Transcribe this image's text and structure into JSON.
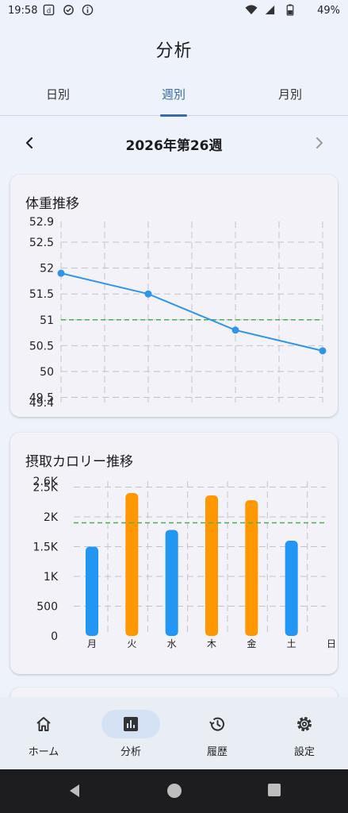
{
  "status_bar": {
    "time": "19:58",
    "battery": "49%"
  },
  "app_bar": {
    "title": "分析"
  },
  "tabs": [
    {
      "label": "日別",
      "active": false
    },
    {
      "label": "週別",
      "active": true
    },
    {
      "label": "月別",
      "active": false
    }
  ],
  "week_nav": {
    "title": "2026年第26週",
    "prev_icon": "chevron-left-icon",
    "next_icon": "chevron-right-icon"
  },
  "weight_card": {
    "title": "体重推移"
  },
  "calorie_card": {
    "title": "摂取カロリー推移"
  },
  "chart_data": [
    {
      "type": "line",
      "title": "体重推移",
      "y_tick_labels": [
        "52.9",
        "52.5",
        "52",
        "51.5",
        "51",
        "50.5",
        "50",
        "49.5",
        "49.4"
      ],
      "ylim": [
        49.4,
        52.9
      ],
      "x_positions": [
        0,
        1,
        2,
        3,
        4,
        5,
        6
      ],
      "series": [
        {
          "points": [
            [
              0,
              51.9
            ],
            [
              2,
              51.5
            ],
            [
              4,
              50.8
            ],
            [
              6,
              50.4
            ]
          ],
          "color": "#2f95e8"
        }
      ],
      "target_line": {
        "value": 51.0,
        "color": "#4caf50"
      },
      "grid": true
    },
    {
      "type": "bar",
      "title": "摂取カロリー推移",
      "categories": [
        "月",
        "火",
        "水",
        "木",
        "金",
        "土",
        "日"
      ],
      "values": [
        1500,
        2400,
        1780,
        2360,
        2280,
        1600,
        0
      ],
      "bar_colors": [
        "#2196f3",
        "#ff9800",
        "#2196f3",
        "#ff9800",
        "#ff9800",
        "#2196f3",
        "#2196f3"
      ],
      "y_tick_labels": [
        "2.6K",
        "2.5K",
        "2K",
        "1.5K",
        "1K",
        "500",
        "0"
      ],
      "ylim": [
        0,
        2600
      ],
      "target_line": {
        "value": 1900,
        "color": "#4caf50"
      },
      "grid": true
    }
  ],
  "bottom_nav": [
    {
      "label": "ホーム",
      "icon": "home-icon",
      "active": false
    },
    {
      "label": "分析",
      "icon": "analytics-icon",
      "active": true
    },
    {
      "label": "履歴",
      "icon": "history-icon",
      "active": false
    },
    {
      "label": "設定",
      "icon": "settings-icon",
      "active": false
    }
  ],
  "colors": {
    "accent": "#3a6aa8",
    "line": "#2f95e8",
    "target": "#4caf50",
    "bar_blue": "#2196f3",
    "bar_orange": "#ff9800"
  }
}
